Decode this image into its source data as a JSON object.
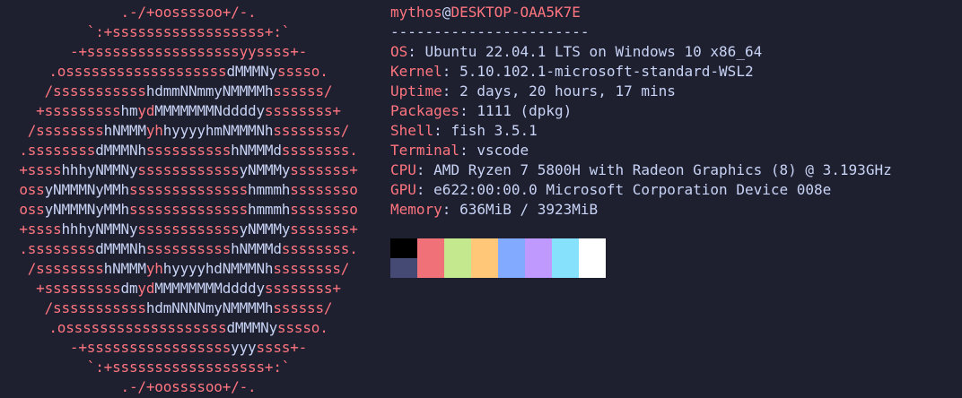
{
  "ascii_logo": {
    "lines": [
      [
        [
          "r",
          ".-/+oossssoo+/-."
        ]
      ],
      [
        [
          "r",
          "`:+ssssssssssssssssss+:`"
        ]
      ],
      [
        [
          "r",
          "-+ssssssssssssssssssyyssss+-"
        ]
      ],
      [
        [
          "r",
          ".osssssssssssssssssss"
        ],
        [
          "w",
          "dMMMNy"
        ],
        [
          "r",
          "sssso."
        ]
      ],
      [
        [
          "r",
          "/sssssssssss"
        ],
        [
          "w",
          "hdmmNNmmyNMMMMh"
        ],
        [
          "r",
          "ssssss/"
        ]
      ],
      [
        [
          "r",
          "+sssssssss"
        ],
        [
          "w",
          "hm"
        ],
        [
          "r",
          "yd"
        ],
        [
          "w",
          "MMMMMMMNddddy"
        ],
        [
          "r",
          "ssssssss+"
        ]
      ],
      [
        [
          "r",
          "/ssssssss"
        ],
        [
          "w",
          "hNMMM"
        ],
        [
          "r",
          "yh"
        ],
        [
          "w",
          "hyyyyhmNMMMNh"
        ],
        [
          "r",
          "ssssssss/"
        ]
      ],
      [
        [
          "r",
          ".ssssssss"
        ],
        [
          "w",
          "dMMMNh"
        ],
        [
          "r",
          "ssssssssss"
        ],
        [
          "w",
          "hNMMMd"
        ],
        [
          "r",
          "ssssssss."
        ]
      ],
      [
        [
          "r",
          "+ssss"
        ],
        [
          "w",
          "hhhyNMMNy"
        ],
        [
          "r",
          "ssssssssssss"
        ],
        [
          "w",
          "yNMMMy"
        ],
        [
          "r",
          "sssssss+"
        ]
      ],
      [
        [
          "r",
          "oss"
        ],
        [
          "w",
          "yNMMMNyMMh"
        ],
        [
          "r",
          "ssssssssssssss"
        ],
        [
          "w",
          "hmmmh"
        ],
        [
          "r",
          "ssssssso"
        ]
      ],
      [
        [
          "r",
          "oss"
        ],
        [
          "w",
          "yNMMMNyMMh"
        ],
        [
          "r",
          "ssssssssssssss"
        ],
        [
          "w",
          "hmmmh"
        ],
        [
          "r",
          "ssssssso"
        ]
      ],
      [
        [
          "r",
          "+ssss"
        ],
        [
          "w",
          "hhhyNMMNy"
        ],
        [
          "r",
          "ssssssssssss"
        ],
        [
          "w",
          "yNMMMy"
        ],
        [
          "r",
          "sssssss+"
        ]
      ],
      [
        [
          "r",
          ".ssssssss"
        ],
        [
          "w",
          "dMMMNh"
        ],
        [
          "r",
          "ssssssssss"
        ],
        [
          "w",
          "hNMMMd"
        ],
        [
          "r",
          "ssssssss."
        ]
      ],
      [
        [
          "r",
          "/ssssssss"
        ],
        [
          "w",
          "hNMMM"
        ],
        [
          "r",
          "yh"
        ],
        [
          "w",
          "hyyyyhdNMMMNh"
        ],
        [
          "r",
          "ssssssss/"
        ]
      ],
      [
        [
          "r",
          "+sssssssss"
        ],
        [
          "w",
          "dm"
        ],
        [
          "r",
          "yd"
        ],
        [
          "w",
          "MMMMMMMMddddy"
        ],
        [
          "r",
          "ssssssss+"
        ]
      ],
      [
        [
          "r",
          "/sssssssssss"
        ],
        [
          "w",
          "hdmNNNNmyNMMMMh"
        ],
        [
          "r",
          "ssssss/"
        ]
      ],
      [
        [
          "r",
          ".osssssssssssssssssss"
        ],
        [
          "w",
          "dMMMNy"
        ],
        [
          "r",
          "sssso."
        ]
      ],
      [
        [
          "r",
          "-+sssssssssssssssss"
        ],
        [
          "w",
          "yyy"
        ],
        [
          "r",
          "ssss+-"
        ]
      ],
      [
        [
          "r",
          "`:+ssssssssssssssssss+:`"
        ]
      ],
      [
        [
          "r",
          ".-/+oossssoo+/-."
        ]
      ]
    ]
  },
  "header": {
    "user": "mythos",
    "at": "@",
    "host": "DESKTOP-OAA5K7E",
    "separator": "-----------------------"
  },
  "info": [
    {
      "key": "OS",
      "value": "Ubuntu 22.04.1 LTS on Windows 10 x86_64"
    },
    {
      "key": "Kernel",
      "value": "5.10.102.1-microsoft-standard-WSL2"
    },
    {
      "key": "Uptime",
      "value": "2 days, 20 hours, 17 mins"
    },
    {
      "key": "Packages",
      "value": "1111 (dpkg)"
    },
    {
      "key": "Shell",
      "value": "fish 3.5.1"
    },
    {
      "key": "Terminal",
      "value": "vscode"
    },
    {
      "key": "CPU",
      "value": "AMD Ryzen 7 5800H with Radeon Graphics (8) @ 3.193GHz"
    },
    {
      "key": "GPU",
      "value": "e622:00:00.0 Microsoft Corporation Device 008e"
    },
    {
      "key": "Memory",
      "value": "636MiB / 3923MiB"
    }
  ],
  "palette": {
    "normal": [
      "#000000",
      "#f07178",
      "#c3e88d",
      "#ffc777",
      "#82aaff",
      "#c099ff",
      "#86e1fc",
      "#ffffff"
    ],
    "bright": [
      "#444a73",
      "#f07178",
      "#c3e88d",
      "#ffc777",
      "#82aaff",
      "#c099ff",
      "#86e1fc",
      "#ffffff"
    ]
  },
  "colors": {
    "accent": "#ff757f",
    "text": "#c8d3f5",
    "background": "#1e2030"
  }
}
